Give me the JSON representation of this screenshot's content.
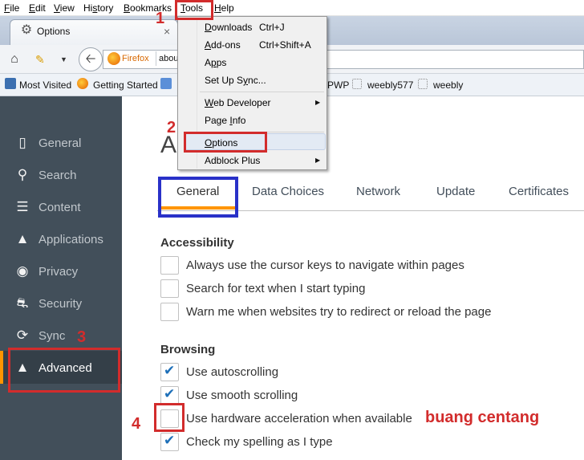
{
  "menubar": {
    "items": [
      {
        "pre": "",
        "u": "F",
        "post": "ile"
      },
      {
        "pre": "",
        "u": "E",
        "post": "dit"
      },
      {
        "pre": "",
        "u": "V",
        "post": "iew"
      },
      {
        "pre": "Hi",
        "u": "s",
        "post": "tory"
      },
      {
        "pre": "",
        "u": "B",
        "post": "ookmarks"
      },
      {
        "pre": "",
        "u": "T",
        "post": "ools"
      },
      {
        "pre": "",
        "u": "H",
        "post": "elp"
      }
    ]
  },
  "browser_tab": {
    "label": "Options",
    "icon": "gear-icon",
    "close": "×"
  },
  "navbar": {
    "identity": "Firefox",
    "url": "abou"
  },
  "bookmarks": {
    "items": [
      "Most Visited",
      "Getting Started",
      "PWP",
      "weebly577",
      "weebly"
    ]
  },
  "tools_menu": {
    "items": [
      {
        "pre": "",
        "u": "D",
        "post": "ownloads",
        "shortcut": "Ctrl+J"
      },
      {
        "pre": "",
        "u": "A",
        "post": "dd-ons",
        "shortcut": "Ctrl+Shift+A"
      },
      {
        "pre": "A",
        "u": "p",
        "post": "ps",
        "shortcut": ""
      },
      {
        "pre": "Set Up S",
        "u": "y",
        "post": "nc...",
        "shortcut": ""
      },
      {
        "pre": "",
        "u": "W",
        "post": "eb Developer",
        "shortcut": ""
      },
      {
        "pre": "Page ",
        "u": "I",
        "post": "nfo",
        "shortcut": ""
      },
      {
        "pre": "",
        "u": "O",
        "post": "ptions",
        "shortcut": ""
      },
      {
        "pre": "Adblock Plus",
        "u": "",
        "post": "",
        "shortcut": ""
      }
    ]
  },
  "sidebar": {
    "items": [
      {
        "label": "General",
        "icon": "general-icon"
      },
      {
        "label": "Search",
        "icon": "search-icon"
      },
      {
        "label": "Content",
        "icon": "content-icon"
      },
      {
        "label": "Applications",
        "icon": "applications-icon"
      },
      {
        "label": "Privacy",
        "icon": "privacy-mask-icon"
      },
      {
        "label": "Security",
        "icon": "security-icon"
      },
      {
        "label": "Sync",
        "icon": "sync-icon"
      },
      {
        "label": "Advanced",
        "icon": "advanced-wizard-hat-icon"
      }
    ],
    "active": "Advanced"
  },
  "main": {
    "heading": "A",
    "tabs": [
      "General",
      "Data Choices",
      "Network",
      "Update",
      "Certificates"
    ],
    "active_tab": "General",
    "sections": [
      {
        "title": "Accessibility",
        "options": [
          {
            "label": "Always use the cursor keys to navigate within pages",
            "checked": false
          },
          {
            "label": "Search for text when I start typing",
            "checked": false
          },
          {
            "label": "Warn me when websites try to redirect or reload the page",
            "checked": false
          }
        ]
      },
      {
        "title": "Browsing",
        "options": [
          {
            "label": "Use autoscrolling",
            "checked": true
          },
          {
            "label": "Use smooth scrolling",
            "checked": true
          },
          {
            "label": "Use hardware acceleration when available",
            "checked": false
          },
          {
            "label": "Check my spelling as I type",
            "checked": true
          }
        ]
      }
    ]
  },
  "annotations": {
    "step1": "1",
    "step2": "2",
    "step3": "3",
    "step4": "4",
    "note": "buang centang",
    "accent_red": "#d22c2c",
    "accent_blue": "#2931c8",
    "accent_orange": "#ff9500"
  }
}
